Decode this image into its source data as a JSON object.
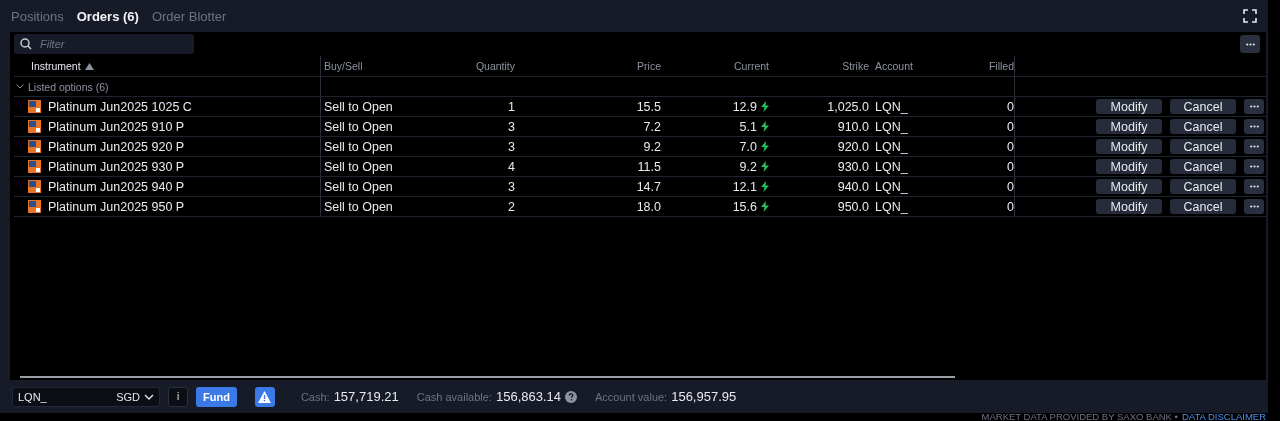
{
  "tabs": [
    {
      "label": "Positions",
      "selected": false
    },
    {
      "label": "Orders (6)",
      "selected": true
    },
    {
      "label": "Order Blotter",
      "selected": false
    }
  ],
  "filter": {
    "placeholder": "Filter"
  },
  "table": {
    "columns": [
      {
        "label": "Instrument",
        "sorted": true
      },
      {
        "label": "Buy/Sell",
        "sorted": false
      },
      {
        "label": "Quantity",
        "sorted": false
      },
      {
        "label": "Price",
        "sorted": false
      },
      {
        "label": "Current",
        "sorted": false
      },
      {
        "label": "Strike",
        "sorted": false
      },
      {
        "label": "Account",
        "sorted": false
      },
      {
        "label": "Filled",
        "sorted": false
      }
    ],
    "group": {
      "label": "Listed options (6)",
      "expanded": true
    },
    "rows": [
      {
        "instrument": "Platinum Jun2025 1025 C",
        "side": "Sell to Open",
        "quantity": "1",
        "price": "15.5",
        "current": "12.9",
        "strike": "1,025.0",
        "account": "LQN_",
        "filled": "0",
        "actions": [
          "Modify",
          "Cancel"
        ]
      },
      {
        "instrument": "Platinum Jun2025 910 P",
        "side": "Sell to Open",
        "quantity": "3",
        "price": "7.2",
        "current": "5.1",
        "strike": "910.0",
        "account": "LQN_",
        "filled": "0",
        "actions": [
          "Modify",
          "Cancel"
        ]
      },
      {
        "instrument": "Platinum Jun2025 920 P",
        "side": "Sell to Open",
        "quantity": "3",
        "price": "9.2",
        "current": "7.0",
        "strike": "920.0",
        "account": "LQN_",
        "filled": "0",
        "actions": [
          "Modify",
          "Cancel"
        ]
      },
      {
        "instrument": "Platinum Jun2025 930 P",
        "side": "Sell to Open",
        "quantity": "4",
        "price": "11.5",
        "current": "9.2",
        "strike": "930.0",
        "account": "LQN_",
        "filled": "0",
        "actions": [
          "Modify",
          "Cancel"
        ]
      },
      {
        "instrument": "Platinum Jun2025 940 P",
        "side": "Sell to Open",
        "quantity": "3",
        "price": "14.7",
        "current": "12.1",
        "strike": "940.0",
        "account": "LQN_",
        "filled": "0",
        "actions": [
          "Modify",
          "Cancel"
        ]
      },
      {
        "instrument": "Platinum Jun2025 950 P",
        "side": "Sell to Open",
        "quantity": "2",
        "price": "18.0",
        "current": "15.6",
        "strike": "950.0",
        "account": "LQN_",
        "filled": "0",
        "actions": [
          "Modify",
          "Cancel"
        ]
      }
    ]
  },
  "footer": {
    "account": "LQN_",
    "currency": "SGD",
    "info_button": "i",
    "fund_button": "Fund",
    "stats": [
      {
        "label": "Cash:",
        "value": "157,719.21",
        "help": false
      },
      {
        "label": "Cash available:",
        "value": "156,863.14",
        "help": true
      },
      {
        "label": "Account value:",
        "value": "156,957.95",
        "help": false
      }
    ]
  },
  "disclaimer": {
    "text": "MARKET DATA PROVIDED BY SAXO BANK •",
    "link": "DATA DISCLAIMER"
  }
}
